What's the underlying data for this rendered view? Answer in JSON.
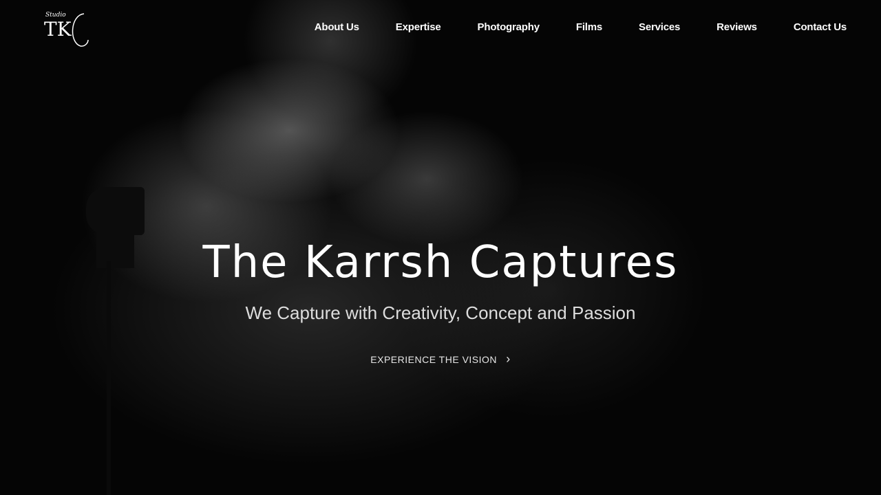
{
  "logo": {
    "text": "Studio TKC"
  },
  "nav": [
    "About Us",
    "Expertise",
    "Photography",
    "Films",
    "Services",
    "Reviews",
    "Contact Us"
  ],
  "hero": {
    "title": "The Karrsh Captures",
    "subtitle": "We Capture with Creativity, Concept and Passion",
    "cta": "EXPERIENCE THE VISION",
    "cta_icon": "›"
  }
}
